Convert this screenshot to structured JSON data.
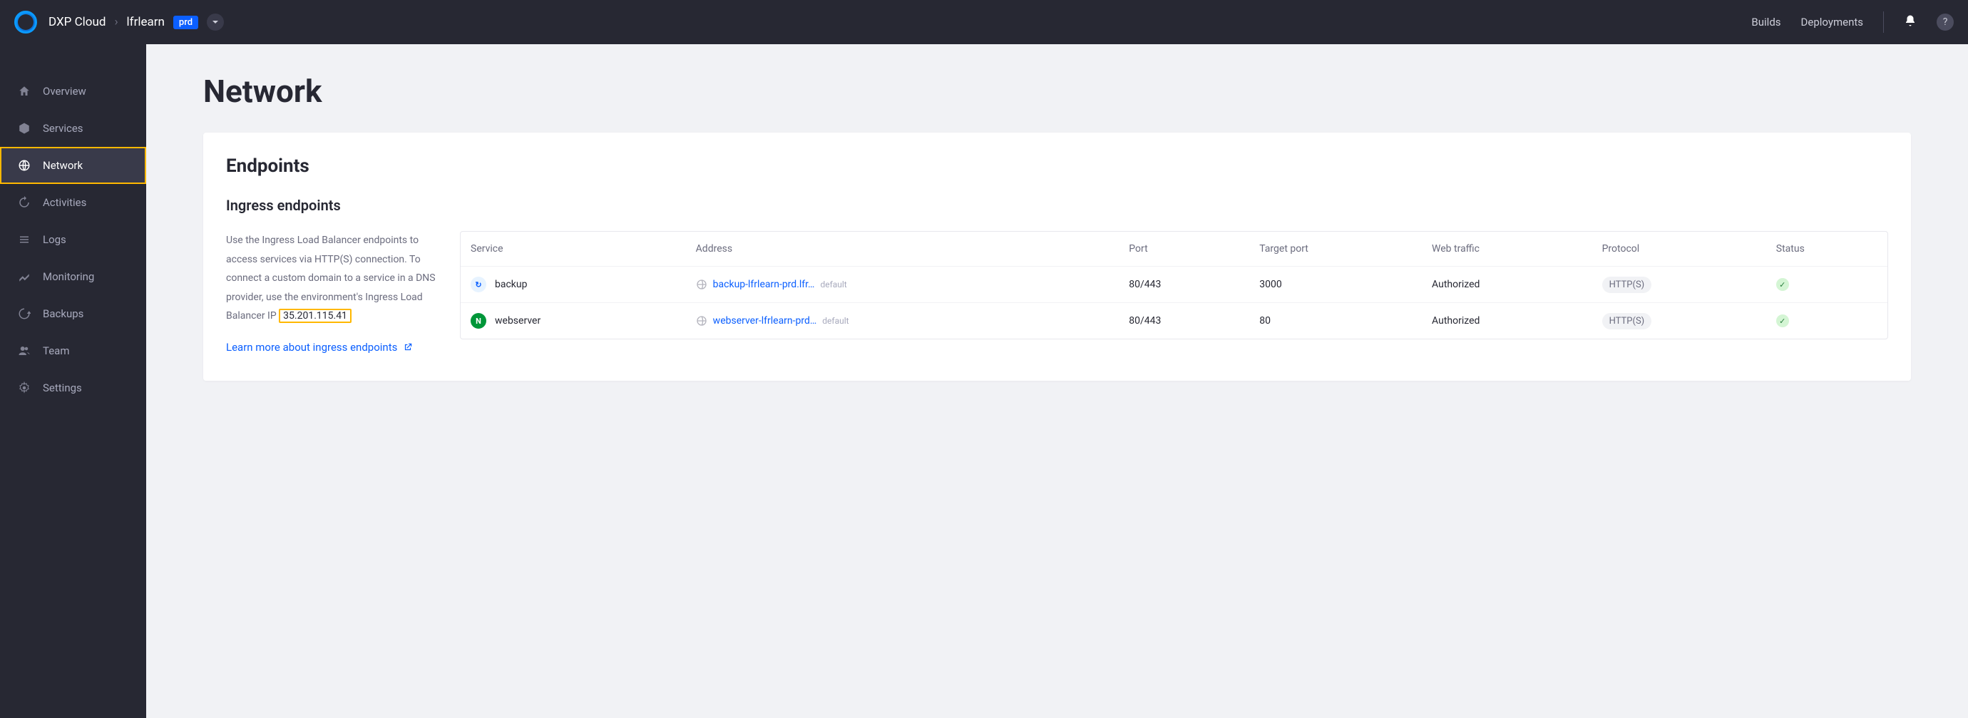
{
  "header": {
    "breadcrumb": {
      "root": "DXP Cloud",
      "project": "lfrlearn",
      "env": "prd"
    },
    "nav": {
      "builds": "Builds",
      "deployments": "Deployments"
    }
  },
  "sidebar": {
    "items": [
      {
        "label": "Overview"
      },
      {
        "label": "Services"
      },
      {
        "label": "Network"
      },
      {
        "label": "Activities"
      },
      {
        "label": "Logs"
      },
      {
        "label": "Monitoring"
      },
      {
        "label": "Backups"
      },
      {
        "label": "Team"
      },
      {
        "label": "Settings"
      }
    ]
  },
  "page": {
    "title": "Network"
  },
  "endpoints": {
    "heading": "Endpoints",
    "subheading": "Ingress endpoints",
    "description_pre": "Use the Ingress Load Balancer endpoints to access services via HTTP(S) connection. To connect a custom domain to a service in a DNS provider, use the environment's Ingress Load Balancer IP ",
    "ip": "35.201.115.41",
    "learn_label": "Learn more about ingress endpoints",
    "columns": {
      "service": "Service",
      "address": "Address",
      "port": "Port",
      "target_port": "Target port",
      "web_traffic": "Web traffic",
      "protocol": "Protocol",
      "status": "Status"
    },
    "rows": [
      {
        "service": "backup",
        "icon": "backup",
        "address": "backup-lfrlearn-prd.lfr…",
        "tag": "default",
        "port": "80/443",
        "target_port": "3000",
        "web_traffic": "Authorized",
        "protocol": "HTTP(S)",
        "status": "ok"
      },
      {
        "service": "webserver",
        "icon": "nginx",
        "address": "webserver-lfrlearn-prd…",
        "tag": "default",
        "port": "80/443",
        "target_port": "80",
        "web_traffic": "Authorized",
        "protocol": "HTTP(S)",
        "status": "ok"
      }
    ]
  }
}
